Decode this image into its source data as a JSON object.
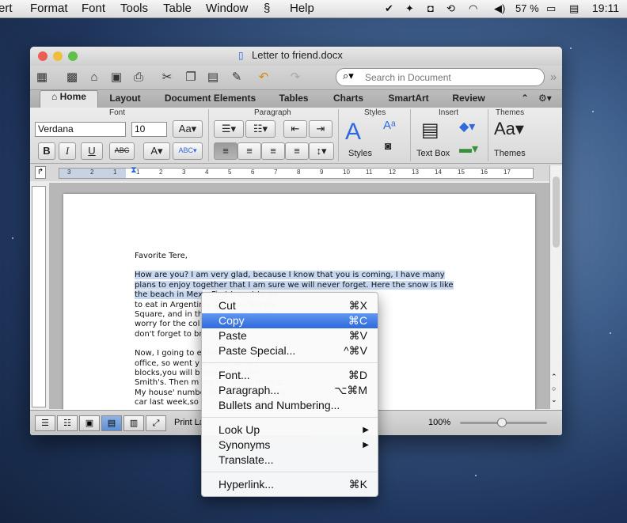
{
  "menubar": {
    "items": [
      "ert",
      "Format",
      "Font",
      "Tools",
      "Table",
      "Window",
      "Help"
    ],
    "battery": "57 %",
    "clock": "19:11"
  },
  "window": {
    "title": "Letter to friend.docx",
    "search_placeholder": "Search in Document"
  },
  "tabs": [
    "Home",
    "Layout",
    "Document Elements",
    "Tables",
    "Charts",
    "SmartArt",
    "Review"
  ],
  "ribbon": {
    "groups": {
      "font": "Font",
      "paragraph": "Paragraph",
      "styles": "Styles",
      "insert": "Insert",
      "themes": "Themes"
    },
    "font_name": "Verdana",
    "font_size": "10",
    "styles_label": "Styles",
    "textbox_label": "Text Box",
    "themes_label": "Themes",
    "bold": "B",
    "italic": "I",
    "underline": "U",
    "strike": "ABC"
  },
  "ruler_numbers": [
    "3",
    "2",
    "1",
    "1",
    "2",
    "3",
    "4",
    "5",
    "6",
    "7",
    "8",
    "9",
    "10",
    "11",
    "12",
    "13",
    "14",
    "15",
    "16",
    "17"
  ],
  "document": {
    "salutation": "Favorite Tere,",
    "p1_selected": "How are you? I am very glad, because I know that you is coming, I have many plans to enjoy together that I am sure we will never forget. Here the snow is like the beach in Mex",
    "p1_rest": "y. First I want to go\nto eat in Argentin                                              o visit the Temple\nSquare, and in th                                                camp there,don't\nworry for the col                                                 week,but please\ndon't forget to br",
    "p2": "Now, I going to e                                                there is a post\noffice, so went y                                                 d right,for five\nblocks,you will b                                                 treet after the\nSmith's. Then m                                                   ost ten steps from it.\nMy house' numbe                                                  ,because I crash my\ncar last week,so"
  },
  "status": {
    "view": "Print La",
    "zoom": "100%"
  },
  "context_menu": {
    "items": [
      {
        "label": "Cut",
        "shortcut": "⌘X"
      },
      {
        "label": "Copy",
        "shortcut": "⌘C",
        "selected": true
      },
      {
        "label": "Paste",
        "shortcut": "⌘V"
      },
      {
        "label": "Paste Special...",
        "shortcut": "^⌘V"
      },
      {
        "label": "Font...",
        "shortcut": "⌘D"
      },
      {
        "label": "Paragraph...",
        "shortcut": "⌥⌘M"
      },
      {
        "label": "Bullets and Numbering...",
        "shortcut": ""
      },
      {
        "label": "Look Up",
        "shortcut": "▶"
      },
      {
        "label": "Synonyms",
        "shortcut": "▶"
      },
      {
        "label": "Translate...",
        "shortcut": ""
      },
      {
        "label": "Hyperlink...",
        "shortcut": "⌘K"
      }
    ]
  },
  "colors": {
    "selection": "#3a73e0",
    "highlight": "#c7d8f0",
    "accent": "#5b8fd5"
  }
}
